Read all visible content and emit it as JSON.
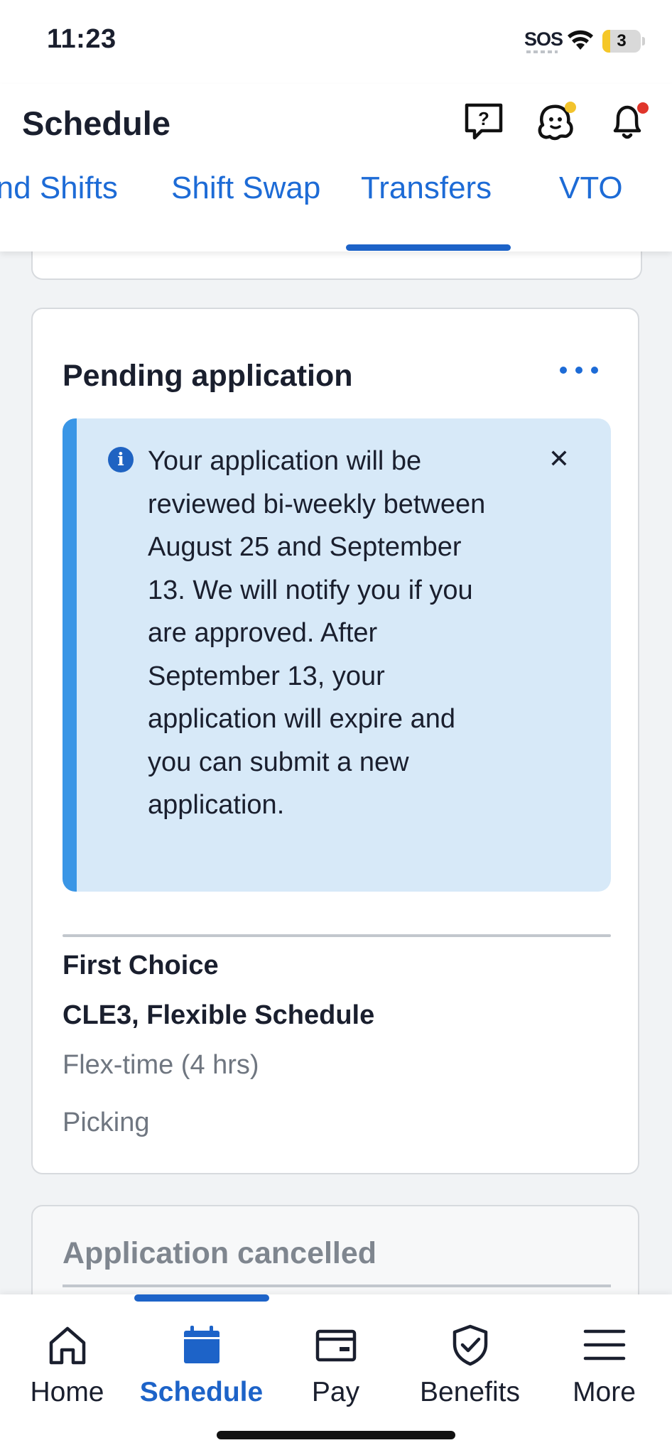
{
  "status_bar": {
    "time": "11:23",
    "sos": "SOS",
    "battery": "3"
  },
  "header": {
    "title": "Schedule"
  },
  "tabs": [
    {
      "label": "Find Shifts"
    },
    {
      "label": "Shift Swap"
    },
    {
      "label": "Transfers",
      "active": true
    },
    {
      "label": "VTO"
    }
  ],
  "pending_card": {
    "title": "Pending application",
    "alert_text": "Your application will be reviewed bi-weekly between August 25 and September 13. We will notify you if you are approved. After September 13, your application will expire and you can submit a new application.",
    "choice_label": "First Choice",
    "choice_site": "CLE3, Flexible Schedule",
    "choice_time": "Flex-time (4 hrs)",
    "choice_role": "Picking"
  },
  "cancelled_card": {
    "title": "Application cancelled"
  },
  "bottom_nav": [
    {
      "label": "Home"
    },
    {
      "label": "Schedule",
      "active": true
    },
    {
      "label": "Pay"
    },
    {
      "label": "Benefits"
    },
    {
      "label": "More"
    }
  ],
  "colors": {
    "accent": "#1d63c8",
    "link": "#1d6bd6",
    "alert_bg": "#d7e9f8",
    "alert_bar": "#3a96e6"
  }
}
